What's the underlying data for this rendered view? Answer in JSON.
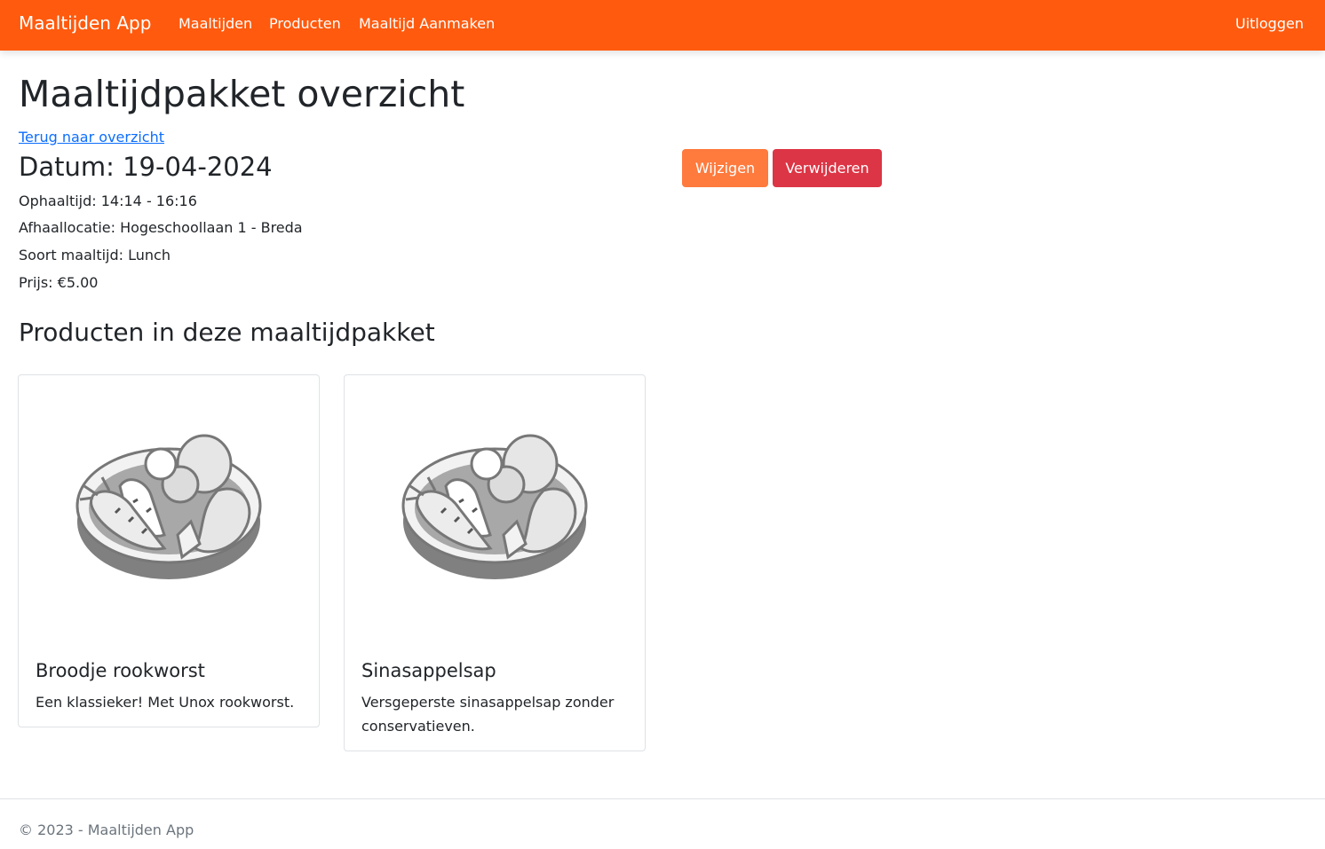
{
  "navbar": {
    "brand": "Maaltijden App",
    "links": [
      "Maaltijden",
      "Producten",
      "Maaltijd Aanmaken"
    ],
    "logout": "Uitloggen",
    "color": "#ff5a0e"
  },
  "page": {
    "title": "Maaltijdpakket overzicht",
    "back_link": "Terug naar overzicht",
    "date": "Datum: 19-04-2024",
    "details": [
      "Ophaaltijd: 14:14 - 16:16",
      "Afhaallocatie: Hogeschoollaan 1 - Breda",
      "Soort maaltijd: Lunch",
      "Prijs: €5.00"
    ]
  },
  "actions": {
    "edit_label": "Wijzigen",
    "delete_label": "Verwijderen",
    "edit_color": "#ff7a3d",
    "delete_color": "#dc3545"
  },
  "products": {
    "heading": "Producten in deze maaltijdpakket",
    "items": [
      {
        "icon": "food-bowl-icon",
        "name": "Broodje rookworst",
        "description": "Een klassieker! Met Unox rookworst."
      },
      {
        "icon": "food-bowl-icon",
        "name": "Sinasappelsap",
        "description": "Versgeperste sinasappelsap zonder conservatieven."
      }
    ]
  },
  "footer": {
    "text": "© 2023 - Maaltijden App"
  }
}
